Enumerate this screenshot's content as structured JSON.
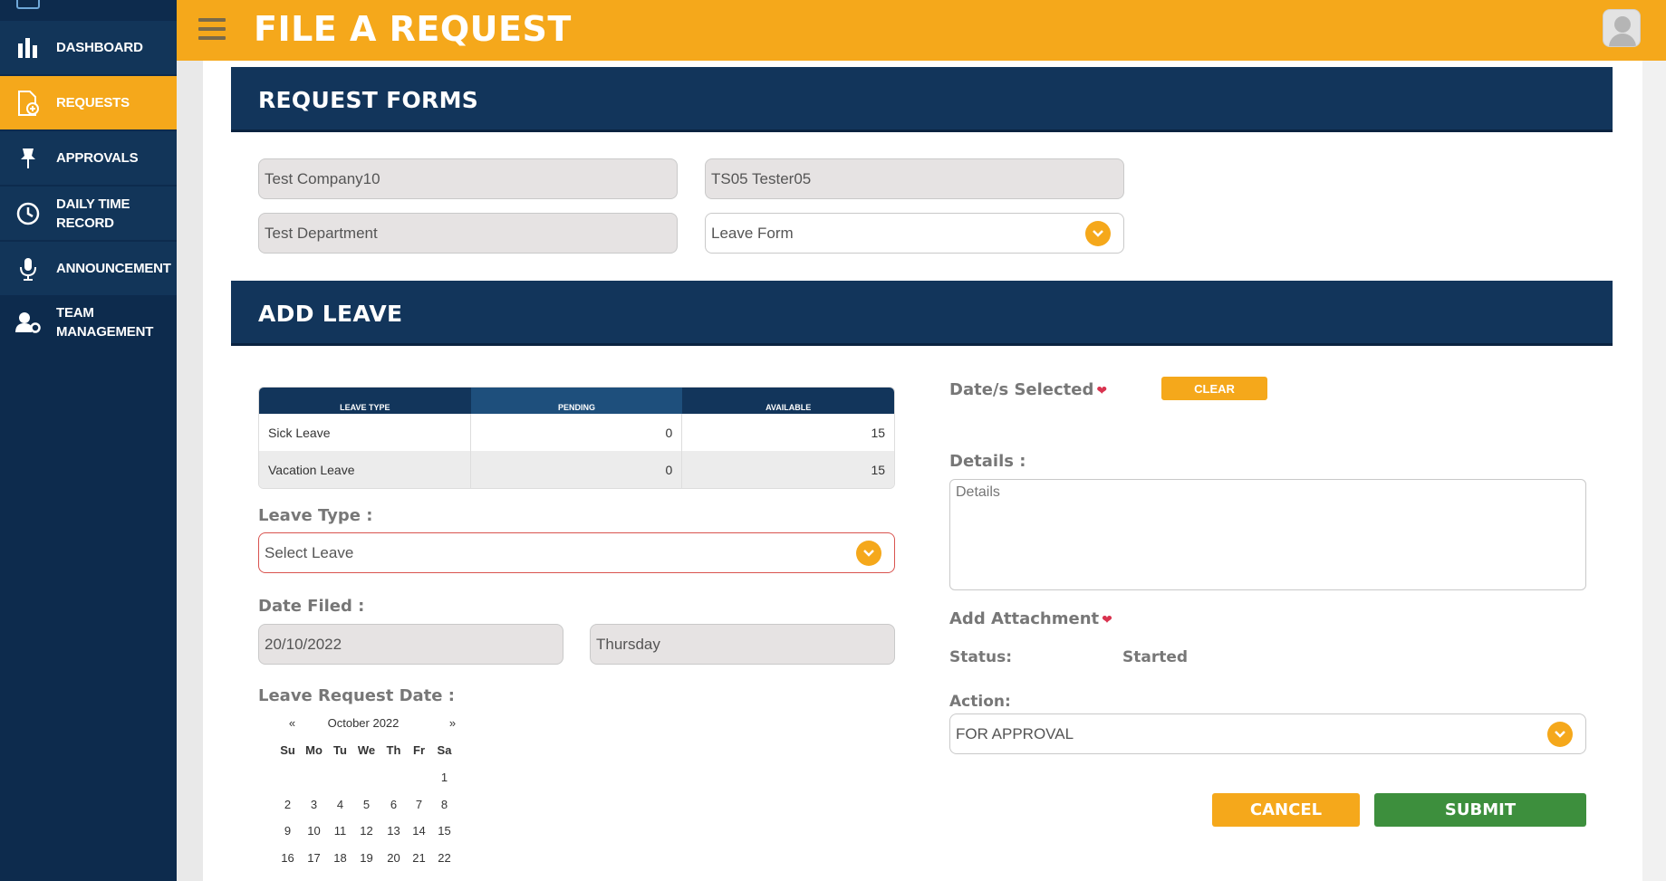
{
  "sidebar": {
    "items": [
      {
        "label": "DASHBOARD",
        "icon": "bar-chart-icon"
      },
      {
        "label": "REQUESTS",
        "icon": "file-add-icon"
      },
      {
        "label": "APPROVALS",
        "icon": "pin-icon"
      },
      {
        "label_line1": "DAILY TIME",
        "label_line2": "RECORD",
        "icon": "clock-icon"
      },
      {
        "label": "ANNOUNCEMENT",
        "icon": "microphone-icon"
      },
      {
        "label_line1": "TEAM",
        "label_line2": "MANAGEMENT",
        "icon": "user-gear-icon"
      }
    ]
  },
  "header": {
    "title": "FILE A REQUEST"
  },
  "request_forms": {
    "title": "REQUEST FORMS",
    "company": "Test Company10",
    "employee": "TS05 Tester05",
    "department": "Test Department",
    "form_type": "Leave Form"
  },
  "add_leave": {
    "title": "ADD LEAVE",
    "table": {
      "headers": [
        "LEAVE TYPE",
        "PENDING",
        "AVAILABLE"
      ],
      "rows": [
        {
          "type": "Sick Leave",
          "pending": "0",
          "available": "15"
        },
        {
          "type": "Vacation Leave",
          "pending": "0",
          "available": "15"
        }
      ]
    },
    "leave_type_label": "Leave Type :",
    "leave_type_value": "Select Leave",
    "date_filed_label": "Date Filed :",
    "date_filed_value": "20/10/2022",
    "day_value": "Thursday",
    "leave_request_date_label": "Leave Request Date :",
    "calendar": {
      "prev": "«",
      "next": "»",
      "month": "October 2022",
      "weekdays": [
        "Su",
        "Mo",
        "Tu",
        "We",
        "Th",
        "Fr",
        "Sa"
      ]
    },
    "dates_selected_label": "Date/s Selected",
    "clear_label": "CLEAR",
    "details_label": "Details :",
    "details_placeholder": "Details",
    "add_attachment_label": "Add Attachment",
    "status_label": "Status:",
    "status_value": "Started",
    "action_label": "Action:",
    "action_value": "FOR APPROVAL",
    "cancel_label": "CANCEL",
    "submit_label": "SUBMIT"
  },
  "colors": {
    "accent": "#f5a81b",
    "navy": "#12355b",
    "submit": "#3d8f3d",
    "error": "#d9534f"
  }
}
